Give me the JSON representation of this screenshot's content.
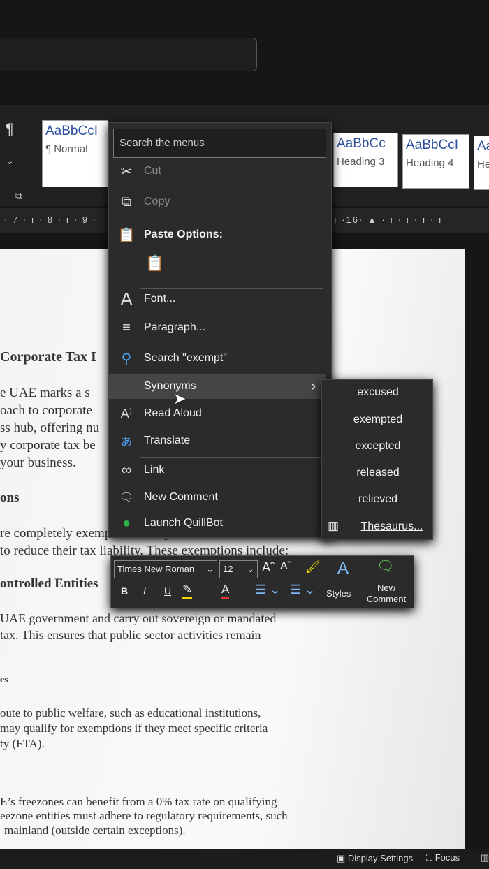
{
  "ribbon": {
    "pilcrow": "¶",
    "styles": [
      {
        "sample": "AaBbCcI",
        "name": "¶ Normal"
      },
      {
        "sample": "AaBbCc",
        "name": "Heading 3"
      },
      {
        "sample": "AaBbCcI",
        "name": "Heading 4"
      },
      {
        "sample": "Aa",
        "name": "He"
      }
    ]
  },
  "ruler": {
    "left": "· 7 · ı · 8 · ı · 9 ·",
    "right": "ı ·16· ▲ · ı · ı · ı · ı"
  },
  "document": {
    "lines": [
      {
        "text": "Corporate Tax I",
        "bold": true
      },
      {
        "text": "e UAE marks a s"
      },
      {
        "text": "oach to corporate"
      },
      {
        "text": "ss hub, offering nu"
      },
      {
        "text": "y corporate tax be"
      },
      {
        "text": "your business."
      },
      {
        "text": "ons",
        "bold": true
      },
      {
        "text": "re completely exempt from corporate tax in the UAE,"
      },
      {
        "text": "to reduce their tax liability. These exemptions include:"
      },
      {
        "text": "ontrolled Entities",
        "bold": true
      },
      {
        "text": "UAE government and carry out sovereign or mandated"
      },
      {
        "text": "tax. This ensures that public sector activities remain"
      },
      {
        "text": "es",
        "bold": true
      },
      {
        "text": "oute to public welfare, such as educational institutions,"
      },
      {
        "text": "may qualify for exemptions if they meet specific criteria"
      },
      {
        "text": "ty (FTA)."
      },
      {
        "text": "E’s freezones can benefit from a 0% tax rate on qualifying"
      },
      {
        "text": "eezone entities must adhere to regulatory requirements, such"
      },
      {
        "text": "mainland (outside certain exceptions)."
      }
    ]
  },
  "context_menu": {
    "search_placeholder": "Search the menus",
    "items": [
      {
        "icon": "cut-icon",
        "glyph": "✂",
        "label": "Cut",
        "disabled": true
      },
      {
        "icon": "copy-icon",
        "glyph": "⧉",
        "label": "Copy",
        "disabled": true
      },
      {
        "icon": "paste-icon",
        "glyph": "📋",
        "label": "Paste Options:"
      },
      {
        "icon": "font-icon",
        "glyph": "A",
        "label": "Font..."
      },
      {
        "icon": "paragraph-icon",
        "glyph": "≡",
        "label": "Paragraph..."
      },
      {
        "icon": "search-icon",
        "glyph": "⚲",
        "label": "Search \"exempt\""
      },
      {
        "icon": "",
        "glyph": "",
        "label": "Synonyms",
        "submenu": "›"
      },
      {
        "icon": "read-aloud-icon",
        "glyph": "A⁾",
        "label": "Read Aloud"
      },
      {
        "icon": "translate-icon",
        "glyph": "あ",
        "label": "Translate"
      },
      {
        "icon": "link-icon",
        "glyph": "∞",
        "label": "Link"
      },
      {
        "icon": "new-comment-icon",
        "glyph": "🗨",
        "label": "New Comment"
      },
      {
        "icon": "quillbot-icon",
        "glyph": "●",
        "label": "Launch QuillBot"
      }
    ]
  },
  "synonyms": {
    "items": [
      "excused",
      "exempted",
      "excepted",
      "released",
      "relieved"
    ],
    "thesaurus": "Thesaurus..."
  },
  "mini_toolbar": {
    "font": "Times New Roman",
    "size": "12",
    "bold": "B",
    "italic": "I",
    "underline": "U",
    "styles": "Styles",
    "new_comment": "New Comment",
    "highlight_color": "#f2d600",
    "font_color": "#e03a2f"
  },
  "status_bar": {
    "display_settings": "Display Settings",
    "focus": "Focus"
  }
}
